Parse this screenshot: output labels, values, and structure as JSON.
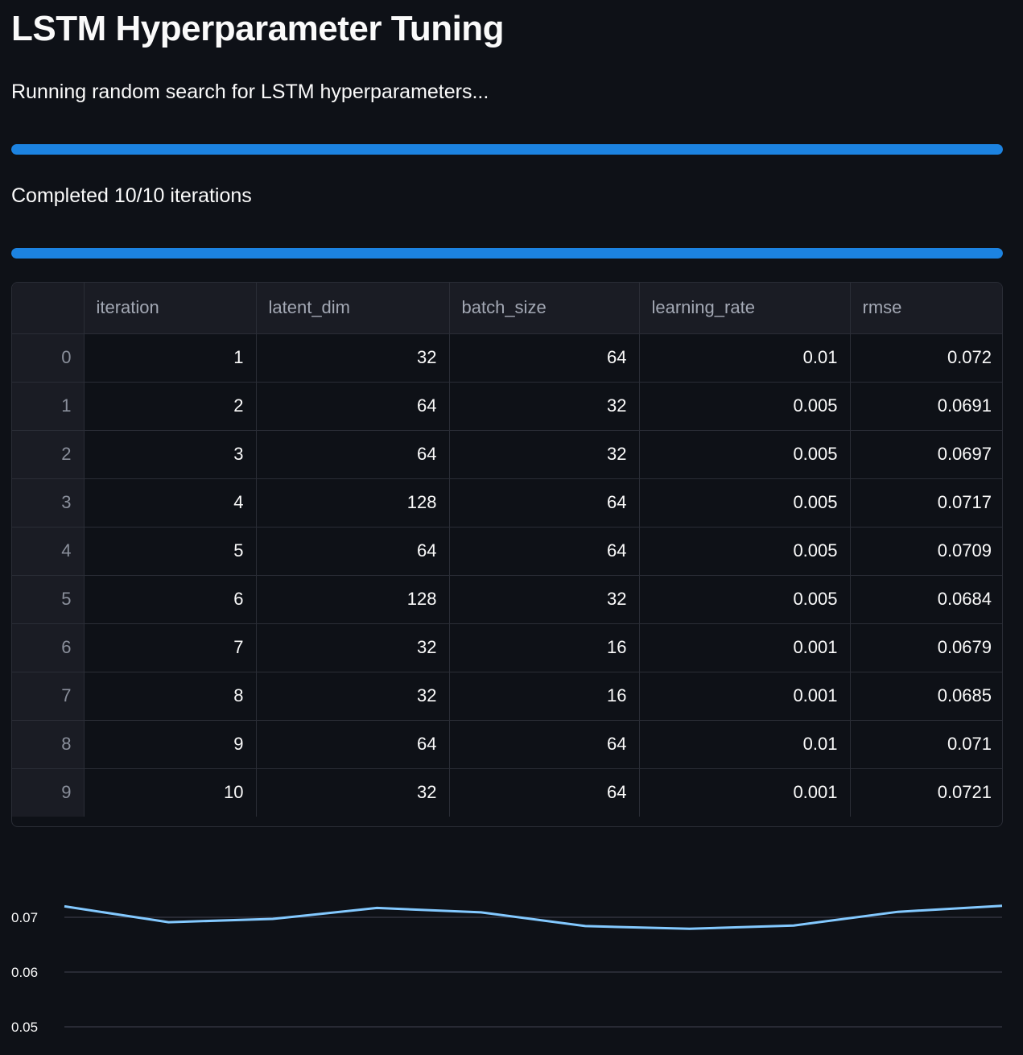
{
  "page": {
    "title": "LSTM Hyperparameter Tuning",
    "subtitle": "Running random search for LSTM hyperparameters...",
    "status_text": "Completed 10/10 iterations"
  },
  "progress": {
    "bar1_fraction": 1.0,
    "bar2_fraction": 1.0
  },
  "table": {
    "columns": [
      "",
      "iteration",
      "latent_dim",
      "batch_size",
      "learning_rate",
      "rmse"
    ],
    "rows": [
      [
        "0",
        "1",
        "32",
        "64",
        "0.01",
        "0.072"
      ],
      [
        "1",
        "2",
        "64",
        "32",
        "0.005",
        "0.0691"
      ],
      [
        "2",
        "3",
        "64",
        "32",
        "0.005",
        "0.0697"
      ],
      [
        "3",
        "4",
        "128",
        "64",
        "0.005",
        "0.0717"
      ],
      [
        "4",
        "5",
        "64",
        "64",
        "0.005",
        "0.0709"
      ],
      [
        "5",
        "6",
        "128",
        "32",
        "0.005",
        "0.0684"
      ],
      [
        "6",
        "7",
        "32",
        "16",
        "0.001",
        "0.0679"
      ],
      [
        "7",
        "8",
        "32",
        "16",
        "0.001",
        "0.0685"
      ],
      [
        "8",
        "9",
        "64",
        "64",
        "0.01",
        "0.071"
      ],
      [
        "9",
        "10",
        "32",
        "64",
        "0.001",
        "0.0721"
      ]
    ]
  },
  "colors": {
    "background": "#0e1117",
    "accent": "#1c83e1",
    "line": "#83c9ff",
    "grid": "#31333f"
  },
  "chart_data": {
    "type": "line",
    "x": [
      1,
      2,
      3,
      4,
      5,
      6,
      7,
      8,
      9,
      10
    ],
    "series": [
      {
        "values": [
          0.072,
          0.0691,
          0.0697,
          0.0717,
          0.0709,
          0.0684,
          0.0679,
          0.0685,
          0.071,
          0.0721
        ]
      }
    ],
    "y_ticks": [
      "0.07",
      "0.06",
      "0.05"
    ],
    "ylim_visible": [
      0.05,
      0.0735
    ],
    "grid": true,
    "legend": "none"
  }
}
